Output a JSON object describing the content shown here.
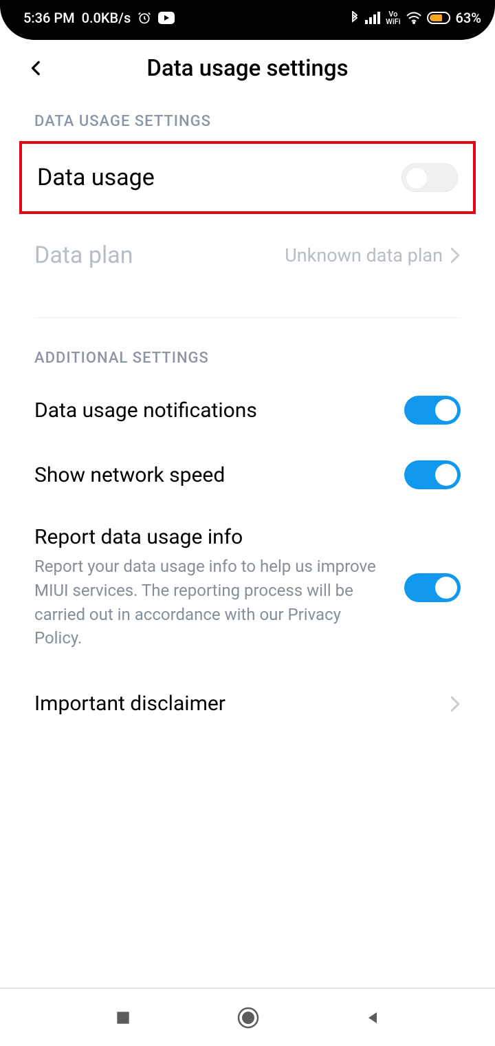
{
  "status": {
    "time": "5:36 PM",
    "speed": "0.0KB/s",
    "battery_pct": "63%"
  },
  "header": {
    "title": "Data usage settings"
  },
  "sections": {
    "data_usage": {
      "header": "DATA USAGE SETTINGS",
      "data_usage_label": "Data usage",
      "data_plan_label": "Data plan",
      "data_plan_value": "Unknown data plan"
    },
    "additional": {
      "header": "ADDITIONAL SETTINGS",
      "notifications_label": "Data usage notifications",
      "network_speed_label": "Show network speed",
      "report_title": "Report data usage info",
      "report_desc": "Report your data usage info to help us improve MIUI services. The reporting process will be carried out in accordance with our Privacy Policy.",
      "disclaimer_label": "Important disclaimer"
    }
  },
  "toggles": {
    "data_usage": false,
    "notifications": true,
    "network_speed": true,
    "report": true
  }
}
